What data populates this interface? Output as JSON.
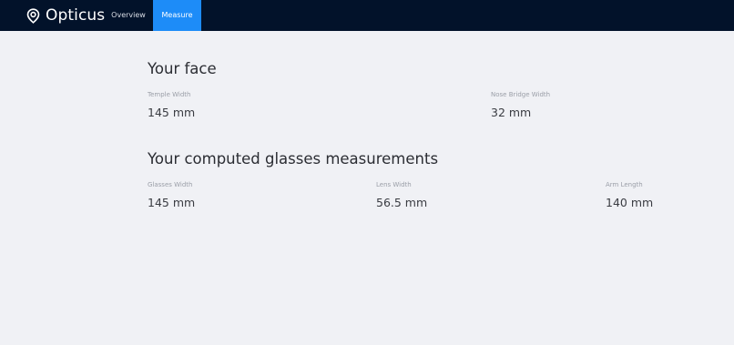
{
  "app": {
    "brand": "Opticus",
    "brand_icon": "location-pin-icon",
    "colors": {
      "topbar": "#02122a",
      "active_tab": "#1d8cf8",
      "background": "#f0f1f5"
    }
  },
  "nav": {
    "items": [
      {
        "label": "Overview",
        "active": false
      },
      {
        "label": "Measure",
        "active": true
      }
    ]
  },
  "face": {
    "title": "Your face",
    "temple_width": {
      "label": "Temple Width",
      "value": "145 mm"
    },
    "nose_bridge_width": {
      "label": "Nose Bridge Width",
      "value": "32 mm"
    }
  },
  "glasses": {
    "title": "Your computed glasses measurements",
    "glasses_width": {
      "label": "Glasses Width",
      "value": "145 mm"
    },
    "lens_width": {
      "label": "Lens Width",
      "value": "56.5 mm"
    },
    "arm_length": {
      "label": "Arm Length",
      "value": "140 mm"
    }
  }
}
